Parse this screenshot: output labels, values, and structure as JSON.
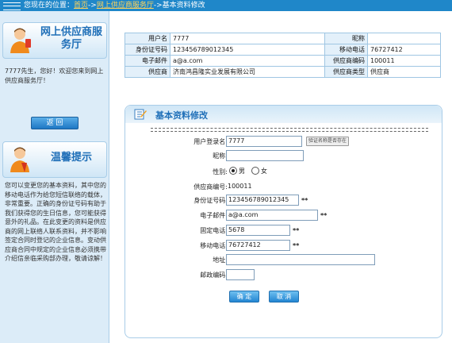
{
  "topbar": {
    "prefix": "您现在的位置：",
    "crumb_home": "首页",
    "sep1": "->",
    "crumb_hall": "网上供应商服务厅",
    "sep2": "->",
    "crumb_current": "基本资料修改"
  },
  "sidebar": {
    "service_title": "网上供应商服务厅",
    "welcome_text": "7777先生，您好！欢迎您来到网上供应商服务厅！",
    "back_label": "返 回",
    "tips_title": "温馨提示",
    "tips_text": "您可以变更您的基本资料，其中您的移动电话作为给您短信联络的载体，非常重要。正确的身份证号码有助于我们获得您的生日信息，您可能获得意外的礼品。在此变更的资料是供应商的网上联络人联系资料，并不影响签定合同时登记的企业信息。变动供应商合同中规定的企业信息必须携带介绍信亲临采购部办理，敬请谅解！"
  },
  "info": {
    "username_label": "用户名",
    "username": "7777",
    "nickname_label": "昵称",
    "nickname": "",
    "idcard_label": "身份证号码",
    "idcard": "123456789012345",
    "mobile_label": "移动电话",
    "mobile": "76727412",
    "email_label": "电子邮件",
    "email": "a@a.com",
    "code_label": "供应商编码",
    "code": "100011",
    "supplier_label": "供应商",
    "supplier": "济南鸿昌隆实业发展有限公司",
    "type_label": "供应商类型",
    "type": "供应商"
  },
  "form": {
    "title": "基本资料修改",
    "login_label": "用户登录名:",
    "login_value": "7777",
    "check_btn": "验证名称是否存在",
    "nickname_label": "昵称:",
    "nickname_value": "",
    "gender_label": "性别:",
    "male": "男",
    "female": "女",
    "gender_selected": "男",
    "code_label": "供应商编号:",
    "code_value": "100011",
    "idcard_label": "身份证号码:",
    "idcard_value": "123456789012345",
    "email_label": "电子邮件:",
    "email_value": "a@a.com",
    "phone_label": "固定电话:",
    "phone_value": "5678",
    "mobile_label": "移动电话:",
    "mobile_value": "76727412",
    "address_label": "地址:",
    "address_value": "",
    "zip_label": "邮政编码:",
    "zip_value": "",
    "required_mark": "**",
    "ok_label": "确 定",
    "cancel_label": "取 消"
  },
  "colors": {
    "topbar": "#1f87c9",
    "accent": "#1f6fb8",
    "sidebar": "#dcecf8"
  }
}
